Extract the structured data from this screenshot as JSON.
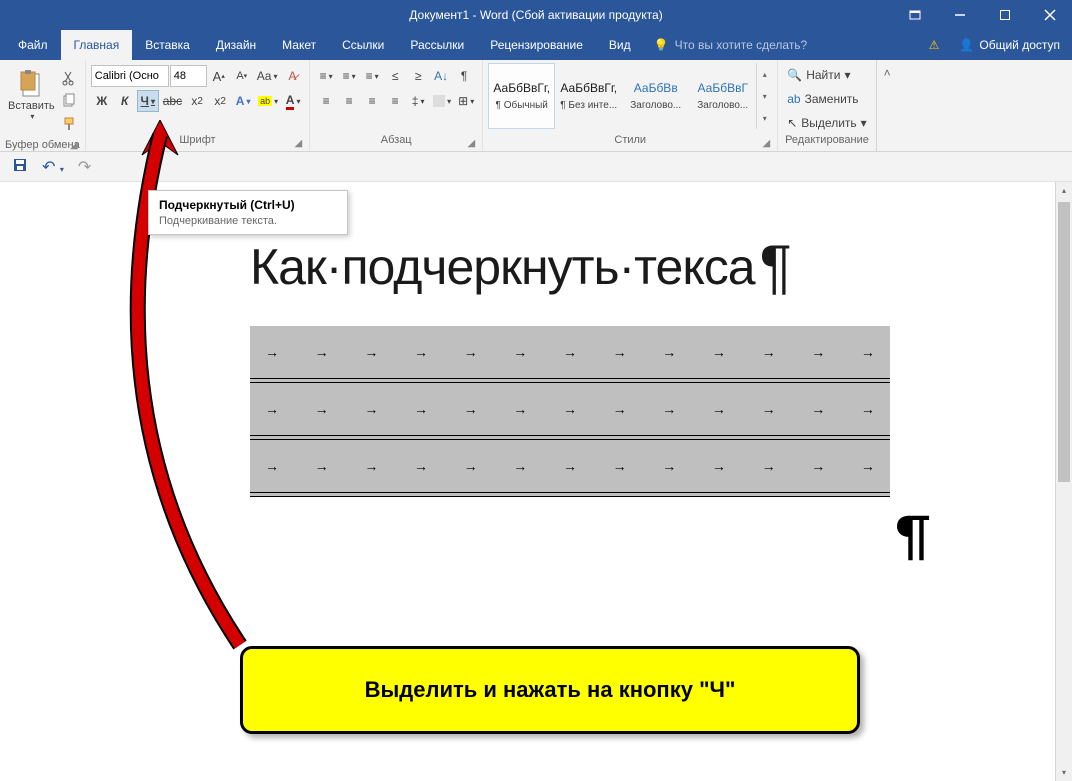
{
  "title": "Документ1 - Word (Сбой активации продукта)",
  "tabs": [
    "Файл",
    "Главная",
    "Вставка",
    "Дизайн",
    "Макет",
    "Ссылки",
    "Рассылки",
    "Рецензирование",
    "Вид"
  ],
  "tell_me": "Что вы хотите сделать?",
  "share": "Общий доступ",
  "ribbon": {
    "clipboard": {
      "paste": "Вставить",
      "label": "Буфер обмена"
    },
    "font": {
      "name": "Calibri (Осно",
      "size": "48",
      "bold": "Ж",
      "italic": "К",
      "underline": "Ч",
      "label": "Шрифт"
    },
    "paragraph": {
      "label": "Абзац"
    },
    "styles": {
      "label": "Стили",
      "items": [
        {
          "preview": "АаБбВвГг,",
          "name": "¶ Обычный"
        },
        {
          "preview": "АаБбВвГг,",
          "name": "¶ Без инте..."
        },
        {
          "preview": "АаБбВв",
          "name": "Заголово...",
          "accent": true
        },
        {
          "preview": "АаБбВвГ",
          "name": "Заголово...",
          "accent": true
        }
      ]
    },
    "editing": {
      "find": "Найти",
      "replace": "Заменить",
      "select": "Выделить",
      "label": "Редактирование"
    }
  },
  "tooltip": {
    "title": "Подчеркнутый (Ctrl+U)",
    "body": "Подчеркивание текста."
  },
  "document": {
    "heading": "Как·подчеркнуть·текса",
    "pilcrow": "¶"
  },
  "callout": "Выделить и нажать на кнопку \"Ч\""
}
